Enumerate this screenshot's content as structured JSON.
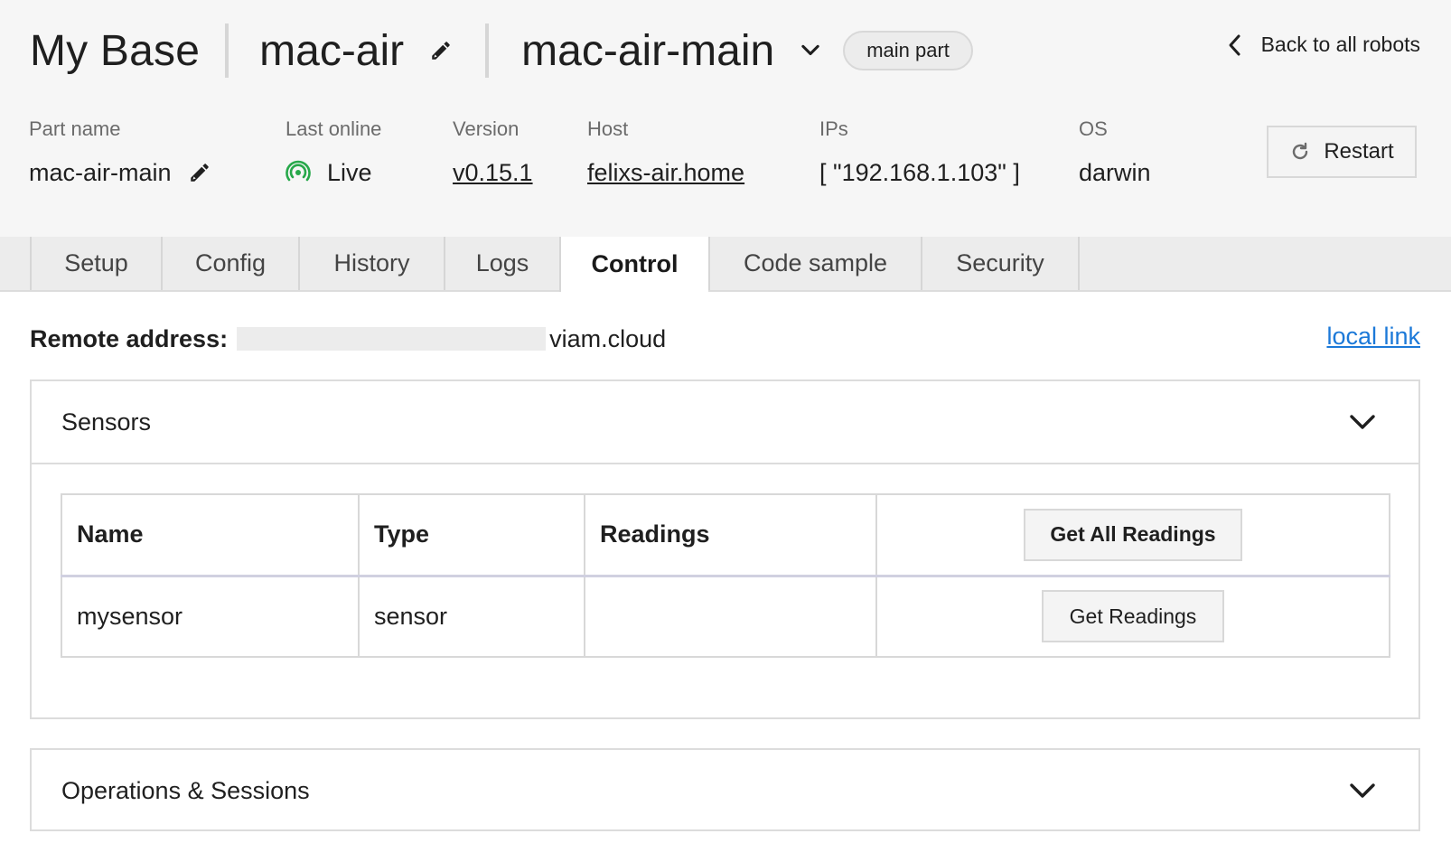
{
  "header": {
    "org_name": "My Base",
    "robot_name": "mac-air",
    "part_name": "mac-air-main",
    "part_badge": "main part",
    "back_label": "Back to all robots"
  },
  "meta": {
    "part_name_label": "Part name",
    "part_name_value": "mac-air-main",
    "last_online_label": "Last online",
    "last_online_value": "Live",
    "version_label": "Version",
    "version_value": "v0.15.1",
    "host_label": "Host",
    "host_value": "felixs-air.home",
    "ips_label": "IPs",
    "ips_value": "[ \"192.168.1.103\" ]",
    "os_label": "OS",
    "os_value": "darwin",
    "restart_label": "Restart"
  },
  "tabs": [
    {
      "label": "Setup",
      "active": false
    },
    {
      "label": "Config",
      "active": false
    },
    {
      "label": "History",
      "active": false
    },
    {
      "label": "Logs",
      "active": false
    },
    {
      "label": "Control",
      "active": true
    },
    {
      "label": "Code sample",
      "active": false
    },
    {
      "label": "Security",
      "active": false
    }
  ],
  "remote": {
    "label": "Remote address:",
    "domain": "viam.cloud",
    "local_link": "local link"
  },
  "sensors_panel": {
    "title": "Sensors",
    "columns": [
      "Name",
      "Type",
      "Readings"
    ],
    "get_all_label": "Get All Readings",
    "rows": [
      {
        "name": "mysensor",
        "type": "sensor",
        "readings": "",
        "button": "Get Readings"
      }
    ]
  },
  "ops_panel": {
    "title": "Operations & Sessions"
  },
  "colors": {
    "live_green": "#27a84a",
    "link_blue": "#1c79d8",
    "header_bg": "#f6f6f6"
  }
}
